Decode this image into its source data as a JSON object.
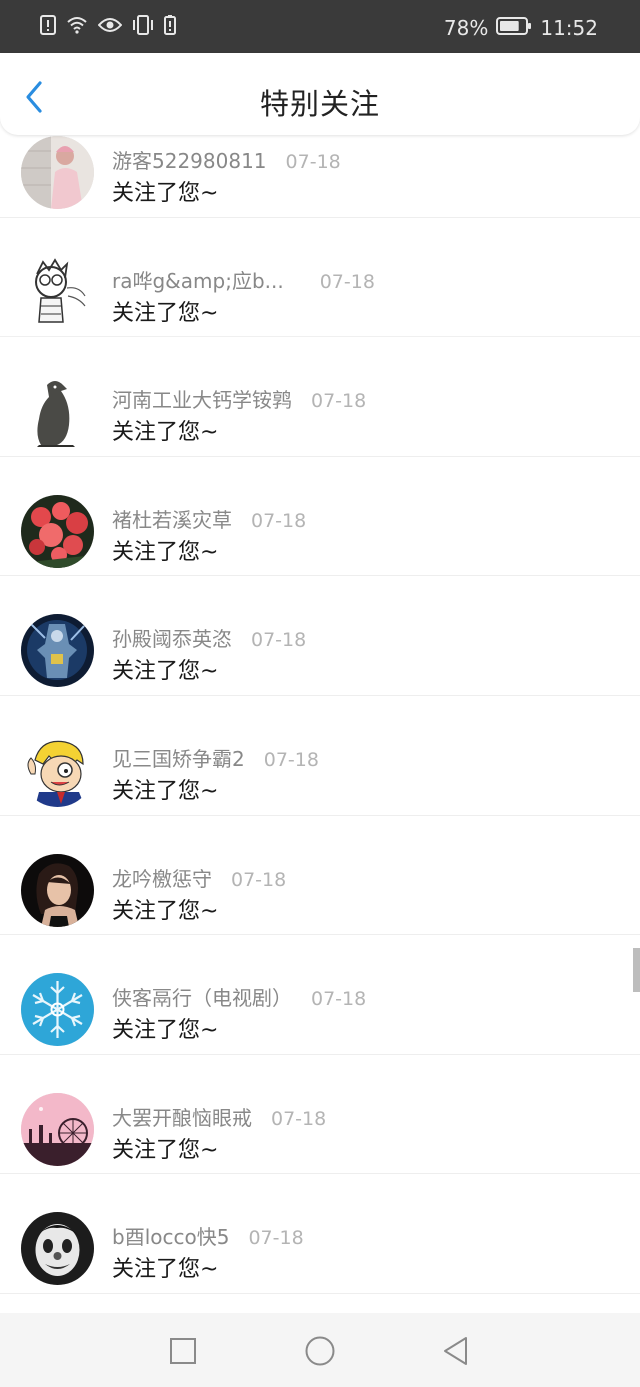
{
  "status_bar": {
    "battery_percent": "78%",
    "time": "11:52",
    "battery_level": 0.78,
    "icons": [
      "alert-icon",
      "wifi-icon",
      "eye-icon",
      "vibrate-icon",
      "battery-saver-icon",
      "battery-icon"
    ]
  },
  "header": {
    "title": "特别关注",
    "back_icon": "chevron-left-icon",
    "accent_color": "#2a8de0"
  },
  "items": [
    {
      "name": "游客522980811",
      "date": "07-18",
      "action": "关注了您~",
      "avatar": "girl-photo"
    },
    {
      "name": "ra哗g&amp;应b...",
      "date": "07-18",
      "action": "关注了您~",
      "avatar": "sketch-character"
    },
    {
      "name": "河南工业大钙学铵鹑",
      "date": "07-18",
      "action": "关注了您~",
      "avatar": "bird-statue"
    },
    {
      "name": "褚杜若溪灾草",
      "date": "07-18",
      "action": "关注了您~",
      "avatar": "red-flowers"
    },
    {
      "name": "孙殿阈忝英恣",
      "date": "07-18",
      "action": "关注了您~",
      "avatar": "robot-art"
    },
    {
      "name": "见三国矫争霸2",
      "date": "07-18",
      "action": "关注了您~",
      "avatar": "cartoon-face"
    },
    {
      "name": "龙吟檄惩守",
      "date": "07-18",
      "action": "关注了您~",
      "avatar": "woman-portrait"
    },
    {
      "name": "侠客鬲行（电视剧）",
      "date": "07-18",
      "action": "关注了您~",
      "avatar": "snowflake"
    },
    {
      "name": "大罢开酿恼眼戒",
      "date": "07-18",
      "action": "关注了您~",
      "avatar": "pink-ferris-wheel"
    },
    {
      "name": "b酉locco快5",
      "date": "07-18",
      "action": "关注了您~",
      "avatar": "clown-face"
    }
  ],
  "nav": {
    "recent_icon": "square-icon",
    "home_icon": "circle-icon",
    "back_icon": "triangle-back-icon"
  }
}
